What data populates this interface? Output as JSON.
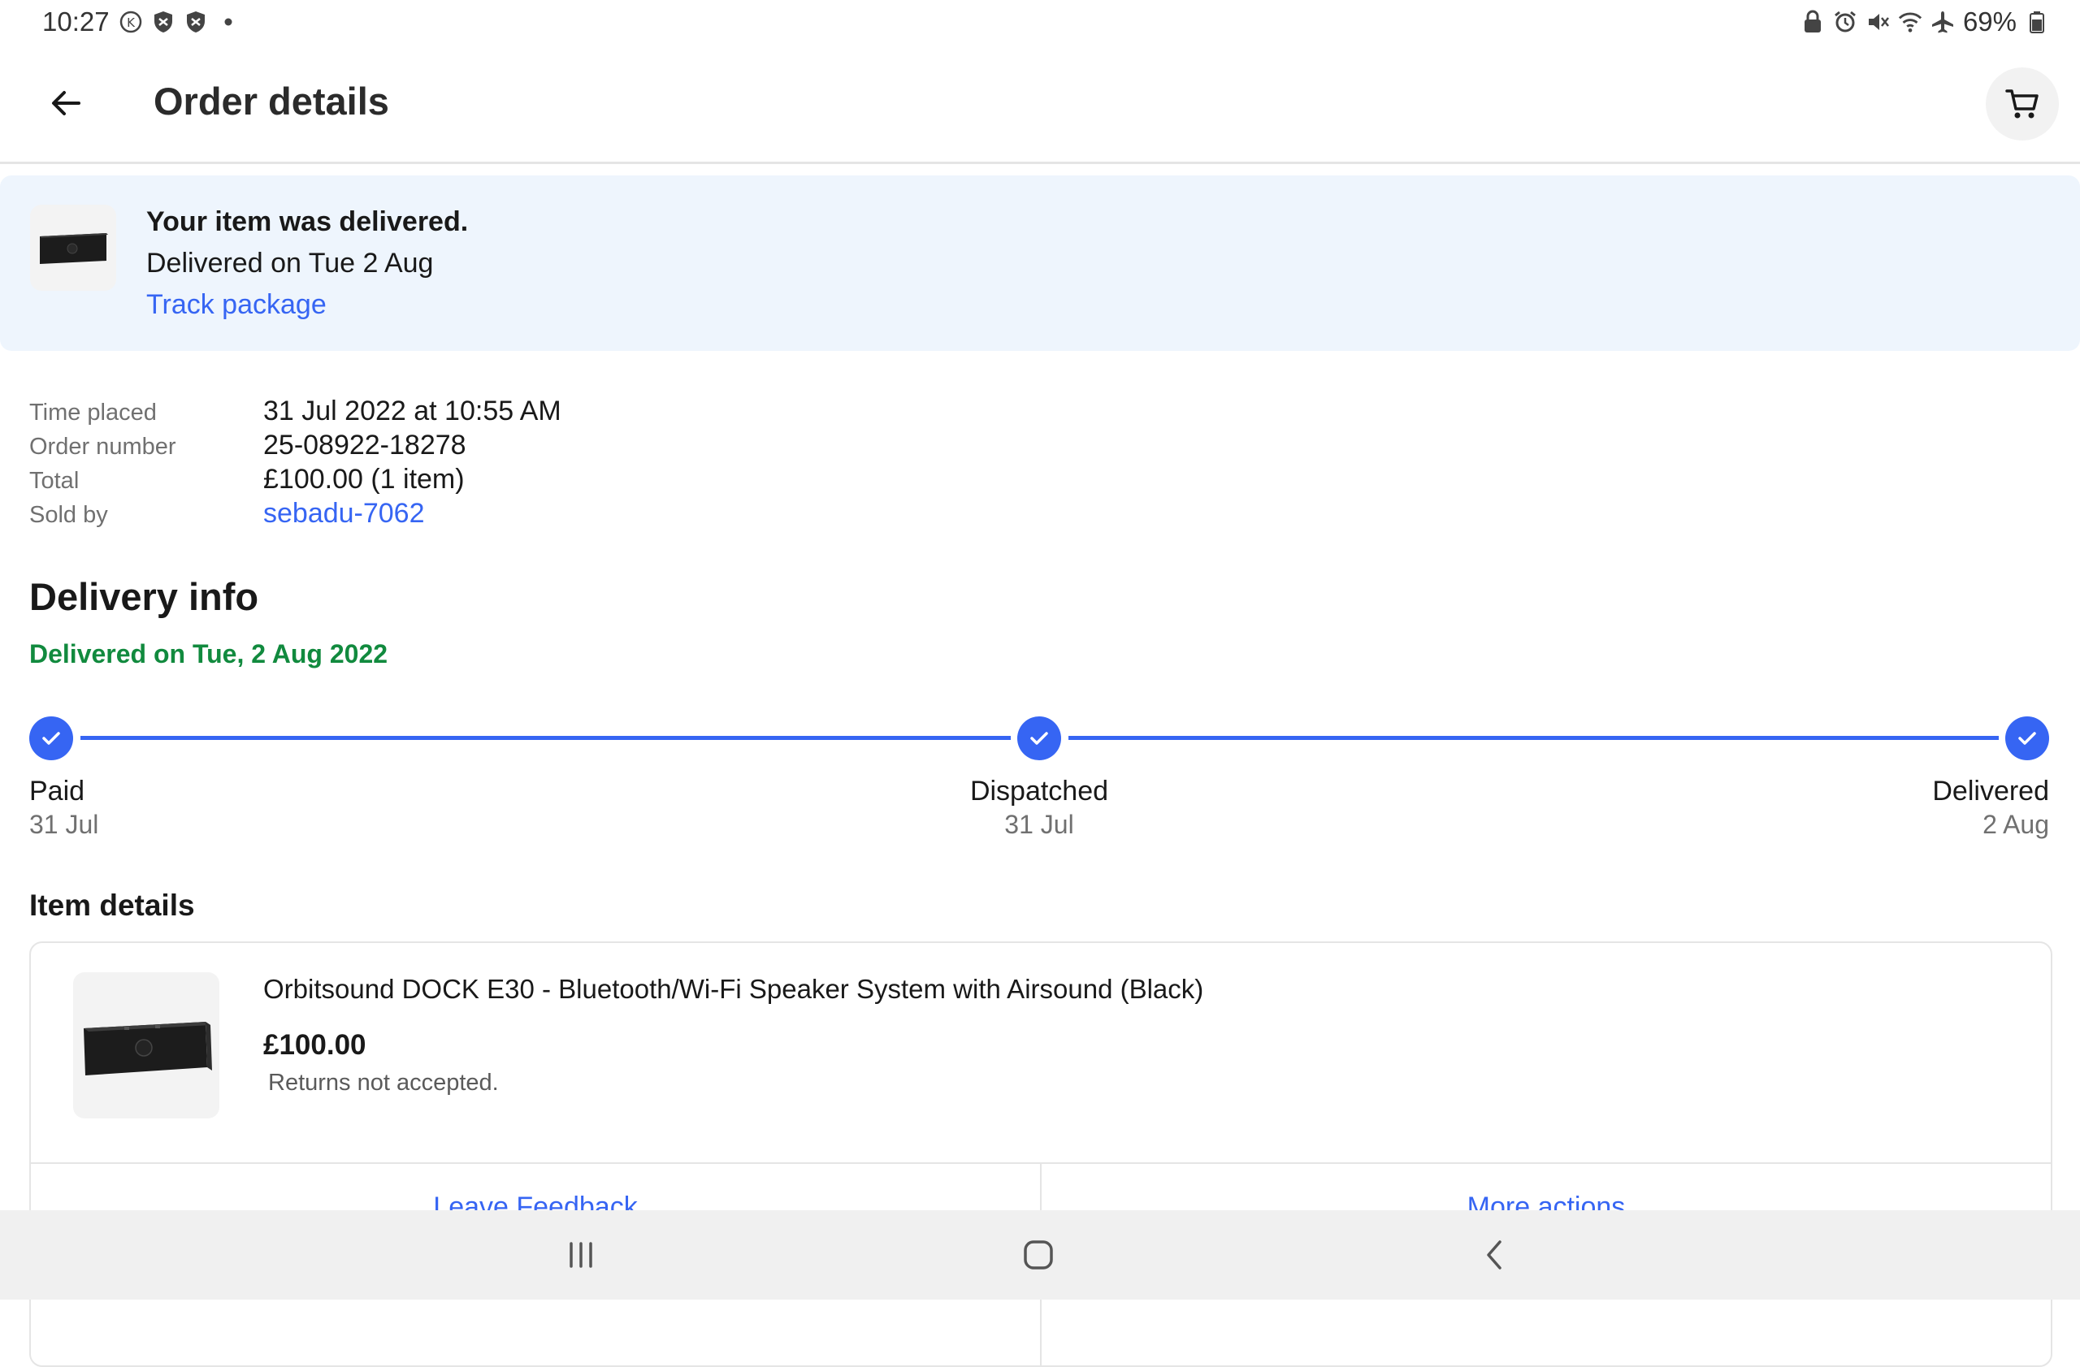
{
  "status_bar": {
    "time": "10:27",
    "left_icons": [
      "k-circle-icon",
      "shield-x-icon",
      "shield-x-icon",
      "dot-icon"
    ],
    "right_icons": [
      "lock-icon",
      "alarm-icon",
      "mute-icon",
      "wifi-icon",
      "airplane-icon"
    ],
    "battery": "69%"
  },
  "header": {
    "title": "Order details"
  },
  "banner": {
    "title": "Your item was delivered.",
    "subtitle": "Delivered on Tue 2 Aug",
    "link": "Track package"
  },
  "order_info": [
    {
      "label": "Time placed",
      "value": "31 Jul 2022 at 10:55 AM"
    },
    {
      "label": "Order number",
      "value": "25-08922-18278"
    },
    {
      "label": "Total",
      "value": "£100.00 (1 item)"
    },
    {
      "label": "Sold by",
      "value": "sebadu-7062"
    }
  ],
  "delivery": {
    "title": "Delivery info",
    "status": "Delivered on Tue, 2 Aug 2022",
    "steps": [
      {
        "label": "Paid",
        "date": "31 Jul"
      },
      {
        "label": "Dispatched",
        "date": "31 Jul"
      },
      {
        "label": "Delivered",
        "date": "2 Aug"
      }
    ]
  },
  "item_details": {
    "title": "Item details",
    "item": {
      "name": "Orbitsound DOCK E30 - Bluetooth/Wi-Fi Speaker System with Airsound (Black)",
      "price": "£100.00",
      "returns": "Returns not accepted."
    },
    "actions": [
      "Leave Feedback",
      "More actions"
    ]
  },
  "colors": {
    "link": "#3665f3",
    "success": "#118a3e",
    "banner_bg": "#eef5fd"
  }
}
